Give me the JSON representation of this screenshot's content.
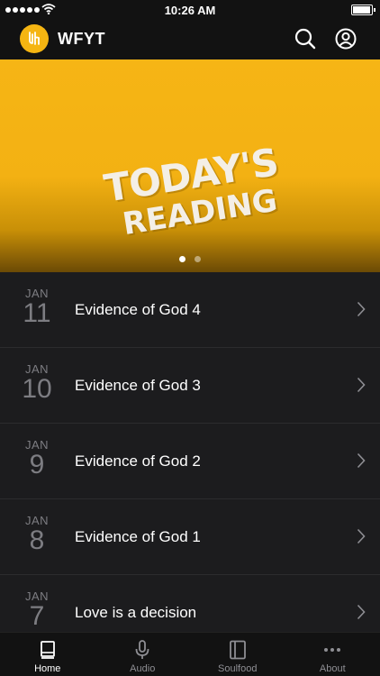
{
  "status_bar": {
    "time": "10:26 AM"
  },
  "header": {
    "title": "WFYT",
    "logo_text": "WFYT"
  },
  "hero": {
    "line1": "TODAY'S",
    "line2": "READING"
  },
  "list": [
    {
      "month": "JAN",
      "day": "11",
      "title": "Evidence of God 4"
    },
    {
      "month": "JAN",
      "day": "10",
      "title": "Evidence of God 3"
    },
    {
      "month": "JAN",
      "day": "9",
      "title": "Evidence of God 2"
    },
    {
      "month": "JAN",
      "day": "8",
      "title": "Evidence of God 1"
    },
    {
      "month": "JAN",
      "day": "7",
      "title": "Love is a decision"
    }
  ],
  "tabs": [
    {
      "label": "Home",
      "icon": "book-icon",
      "active": true
    },
    {
      "label": "Audio",
      "icon": "microphone-icon",
      "active": false
    },
    {
      "label": "Soulfood",
      "icon": "journal-icon",
      "active": false
    },
    {
      "label": "About",
      "icon": "more-icon",
      "active": false
    }
  ],
  "colors": {
    "accent": "#f5b512",
    "background": "#1c1c1e",
    "bar": "#121212",
    "muted": "#7d7d82"
  }
}
